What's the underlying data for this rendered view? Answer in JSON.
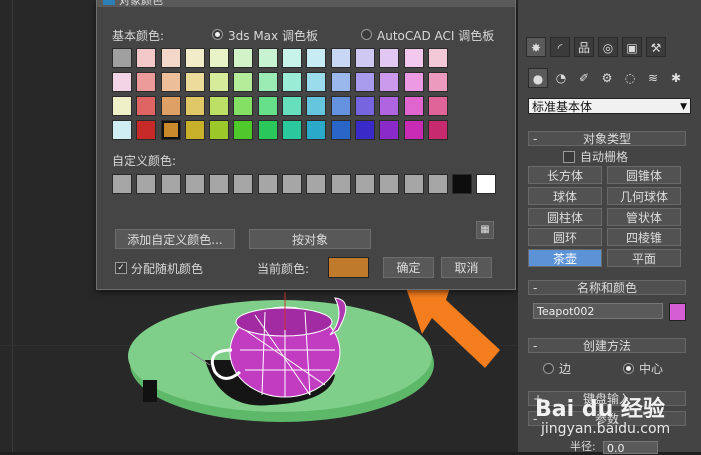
{
  "dialog": {
    "title": "对象颜色",
    "basic_colors_label": "基本颜色:",
    "palette_3dsmax": "3ds Max 调色板",
    "palette_autocad": "AutoCAD ACI 调色板",
    "custom_colors_label": "自定义颜色:",
    "add_custom_button": "添加自定义颜色...",
    "by_object_button": "按对象",
    "random_label": "分配随机颜色",
    "current_color_label": "当前颜色:",
    "current_color": "#c07a2c",
    "ok_button": "确定",
    "cancel_button": "取消",
    "basic_rows": [
      [
        "#a0a0a0",
        "#f3c8c8",
        "#f3d7c8",
        "#f3ecc8",
        "#e8f3c8",
        "#d2f3c8",
        "#c8f3d2",
        "#c8f3e8",
        "#c8ecf3",
        "#c8d7f3",
        "#cec8f3",
        "#e0c8f3",
        "#f3c8ee",
        "#f3c8d7"
      ],
      [
        "#f3d3e6",
        "#ec9a9a",
        "#ecbf9a",
        "#ecdb9a",
        "#d7ec9a",
        "#b4ec9a",
        "#9aecb4",
        "#9aecd7",
        "#9adbec",
        "#9ab8ec",
        "#a89aec",
        "#cb9aec",
        "#ec9ae2",
        "#ec9abd"
      ],
      [
        "#eef0c8",
        "#df6565",
        "#dfa065",
        "#dfc865",
        "#bcdf65",
        "#84df65",
        "#65df88",
        "#65dfbc",
        "#65c5df",
        "#6592df",
        "#7765df",
        "#ae65df",
        "#df65cf",
        "#df6598"
      ],
      [
        "#cfeef3",
        "#c82a2a",
        "#c88a2a",
        "#c8b02a",
        "#9cc82a",
        "#4ec82a",
        "#2ac85a",
        "#2ac89c",
        "#2aaac8",
        "#2a66c8",
        "#3a2ac8",
        "#8a2ac8",
        "#c82ab4",
        "#c82a70"
      ]
    ],
    "selected_basic": "3-2",
    "custom_colors": [
      "#a6a6a6",
      "#a6a6a6",
      "#a6a6a6",
      "#a6a6a6",
      "#a6a6a6",
      "#a6a6a6",
      "#a6a6a6",
      "#a6a6a6",
      "#a6a6a6",
      "#a6a6a6",
      "#a6a6a6",
      "#a6a6a6",
      "#a6a6a6",
      "#a6a6a6",
      "#0d0d0d",
      "#ffffff"
    ]
  },
  "panel": {
    "tabs": [
      "create-icon",
      "modify-icon",
      "hierarchy-icon",
      "motion-icon",
      "display-icon",
      "utilities-icon"
    ],
    "subtabs": [
      "geometry-icon",
      "shapes-icon",
      "lights-icon",
      "cameras-icon",
      "helpers-icon",
      "spacewarps-icon",
      "systems-icon"
    ],
    "category": "标准基本体",
    "object_type_title": "对象类型",
    "autogrid_label": "自动栅格",
    "objects": [
      [
        "长方体",
        "圆锥体"
      ],
      [
        "球体",
        "几何球体"
      ],
      [
        "圆柱体",
        "管状体"
      ],
      [
        "圆环",
        "四棱锥"
      ],
      [
        "茶壶",
        "平面"
      ]
    ],
    "active_object": "茶壶",
    "name_color_title": "名称和颜色",
    "object_name": "Teapot002",
    "object_color": "#d55ed5",
    "creation_title": "创建方法",
    "creation_options": [
      "边",
      "中心"
    ],
    "creation_selected": "中心",
    "keyboard_title": "键盘输入",
    "params_title": "参数",
    "radius_label": "半径:",
    "radius_value": "0.0"
  },
  "watermark": {
    "line1": "Bai du 经验",
    "line2": "jingyan.baidu.com"
  }
}
